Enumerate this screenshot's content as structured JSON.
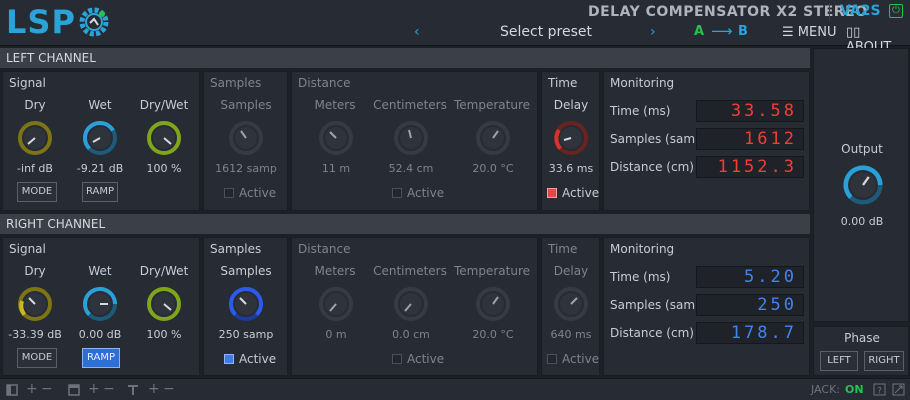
{
  "header": {
    "logo": "LSP",
    "title": "DELAY COMPENSATOR X2 STEREO",
    "id": "VA2S",
    "preset_prev": "‹",
    "preset_name": "Select preset",
    "preset_next": "›",
    "ab_a": "A",
    "ab_arrow": "⟶",
    "ab_b": "B",
    "menu": "☰ MENU",
    "about": "▯▯ ABOUT",
    "power_icon": "⏻"
  },
  "left": {
    "header": "LEFT CHANNEL",
    "signal": {
      "title": "Signal",
      "dry_label": "Dry",
      "wet_label": "Wet",
      "drywet_label": "Dry/Wet",
      "dry_value": "-inf dB",
      "wet_value": "-9.21 dB",
      "drywet_value": "100 %",
      "mode": "MODE",
      "ramp": "RAMP"
    },
    "samples": {
      "title": "Samples",
      "label": "Samples",
      "value": "1612 samp",
      "active": "Active"
    },
    "distance": {
      "title": "Distance",
      "meters_label": "Meters",
      "cm_label": "Centimeters",
      "temp_label": "Temperature",
      "meters_value": "11 m",
      "cm_value": "52.4 cm",
      "temp_value": "20.0 °C",
      "active": "Active"
    },
    "time": {
      "title": "Time",
      "label": "Delay",
      "value": "33.6 ms",
      "active": "Active"
    },
    "monitoring": {
      "title": "Monitoring",
      "time_label": "Time (ms)",
      "samples_label": "Samples (samp)",
      "distance_label": "Distance (cm)",
      "time_value": "33.58",
      "samples_value": "1612",
      "distance_value": "1152.3"
    }
  },
  "right": {
    "header": "RIGHT CHANNEL",
    "signal": {
      "title": "Signal",
      "dry_label": "Dry",
      "wet_label": "Wet",
      "drywet_label": "Dry/Wet",
      "dry_value": "-33.39 dB",
      "wet_value": "0.00 dB",
      "drywet_value": "100 %",
      "mode": "MODE",
      "ramp": "RAMP"
    },
    "samples": {
      "title": "Samples",
      "label": "Samples",
      "value": "250 samp",
      "active": "Active"
    },
    "distance": {
      "title": "Distance",
      "meters_label": "Meters",
      "cm_label": "Centimeters",
      "temp_label": "Temperature",
      "meters_value": "0 m",
      "cm_value": "0.0 cm",
      "temp_value": "20.0 °C",
      "active": "Active"
    },
    "time": {
      "title": "Time",
      "label": "Delay",
      "value": "640 ms",
      "active": "Active"
    },
    "monitoring": {
      "title": "Monitoring",
      "time_label": "Time (ms)",
      "samples_label": "Samples (samp)",
      "distance_label": "Distance (cm)",
      "time_value": "5.20",
      "samples_value": "250",
      "distance_value": "178.7"
    }
  },
  "output": {
    "label": "Output",
    "value": "0.00 dB"
  },
  "phase": {
    "label": "Phase",
    "left": "LEFT",
    "right": "RIGHT"
  },
  "footer": {
    "jack_label": "JACK:",
    "jack_status": "ON"
  },
  "colors": {
    "accent": "#2aa4d8",
    "green": "#26c24c",
    "red_lcd": "#ef4036",
    "blue_lcd": "#3f86f0"
  }
}
